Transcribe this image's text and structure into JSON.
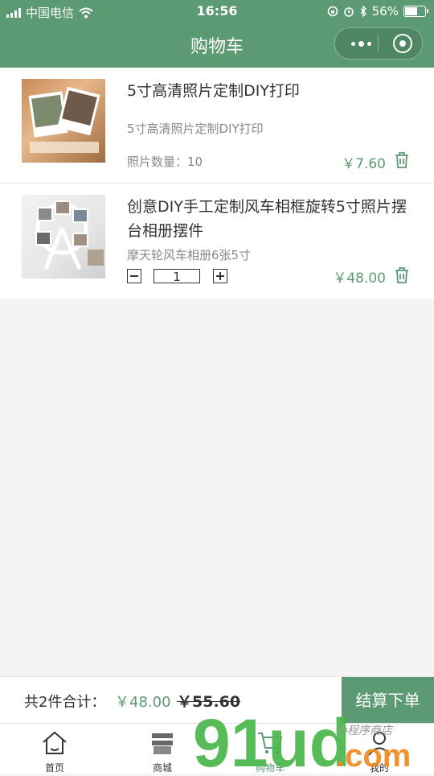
{
  "status_bar": {
    "carrier": "中国电信",
    "time": "16:56",
    "battery": "56%"
  },
  "navbar": {
    "title": "购物车"
  },
  "cart": {
    "items": [
      {
        "name": "5寸高清照片定制DIY打印",
        "sub": "5寸高清照片定制DIY打印",
        "qty_label": "照片数量：10",
        "price": "￥7.60",
        "thumb_icon": "photo-prints-image"
      },
      {
        "name": "创意DIY手工定制风车相框旋转5寸照片摆台相册摆件",
        "sub": "摩天轮风车相册6张5寸",
        "quantity": "1",
        "price": "￥48.00",
        "thumb_icon": "ferris-wheel-frame-image"
      }
    ]
  },
  "footer": {
    "summary": "共2件合计：",
    "total": "￥48.00",
    "original": "￥55.60",
    "checkout": "结算下单"
  },
  "tabs": [
    {
      "label": "首页",
      "icon": "home-icon"
    },
    {
      "label": "商城",
      "icon": "store-icon"
    },
    {
      "label": "购物车",
      "icon": "cart-icon",
      "active": true
    },
    {
      "label": "我的",
      "icon": "user-icon"
    }
  ],
  "watermark": {
    "text": "91ud.com",
    "subtext": "小程序商店"
  },
  "colors": {
    "accent": "#5b9a72",
    "text": "#333333",
    "muted": "#888888"
  }
}
